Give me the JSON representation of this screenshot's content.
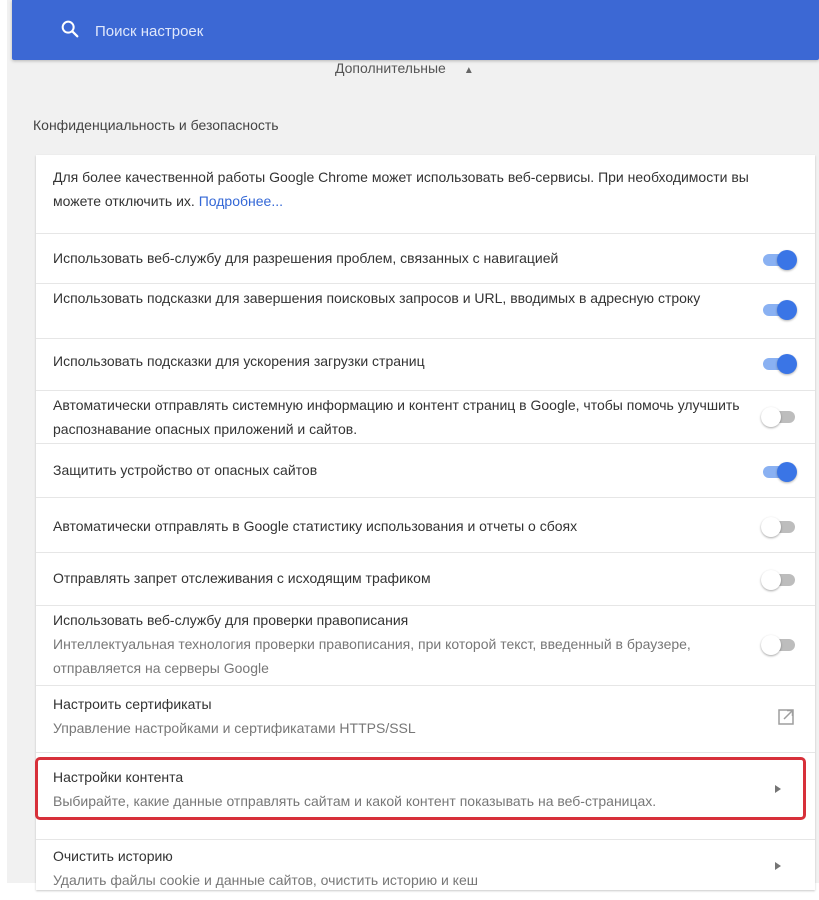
{
  "search": {
    "placeholder": "Поиск настроек"
  },
  "advanced": {
    "label": "Дополнительные"
  },
  "section": {
    "title": "Конфиденциальность и безопасность"
  },
  "intro": {
    "text": "Для более качественной работы Google Chrome может использовать веб-сервисы. При необходимости вы можете отключить их. ",
    "link": "Подробнее..."
  },
  "rows": [
    {
      "label": "Использовать веб-службу для разрешения проблем, связанных с навигацией",
      "enabled": true
    },
    {
      "label": "Использовать подсказки для завершения поисковых запросов и URL, вводимых в адресную строку",
      "enabled": true
    },
    {
      "label": "Использовать подсказки для ускорения загрузки страниц",
      "enabled": true
    },
    {
      "label": "Автоматически отправлять системную информацию и контент страниц в Google, чтобы помочь улучшить распознавание опасных приложений и сайтов.",
      "enabled": false
    },
    {
      "label": "Защитить устройство от опасных сайтов",
      "enabled": true
    },
    {
      "label": "Автоматически отправлять в Google статистику использования и отчеты о сбоях",
      "enabled": false
    },
    {
      "label": "Отправлять запрет отслеживания с исходящим трафиком",
      "enabled": false
    },
    {
      "label": "Использовать веб-службу для проверки правописания",
      "sublabel": "Интеллектуальная технология проверки правописания, при которой текст, введенный в браузере, отправляется на серверы Google",
      "enabled": false
    }
  ],
  "links": [
    {
      "label": "Настроить сертификаты",
      "sublabel": "Управление настройками и сертификатами HTTPS/SSL",
      "icon": "external-link-icon"
    },
    {
      "label": "Настройки контента",
      "sublabel": "Выбирайте, какие данные отправлять сайтам и какой контент показывать на веб-страницах.",
      "icon": "chevron-right-icon"
    },
    {
      "label": "Очистить историю",
      "sublabel": "Удалить файлы cookie и данные сайтов, очистить историю и кеш",
      "icon": "chevron-right-icon"
    }
  ],
  "colors": {
    "header": "#3c68d4",
    "toggle_on": "#3a75e6",
    "link": "#3367d6",
    "highlight": "#d7303a"
  }
}
